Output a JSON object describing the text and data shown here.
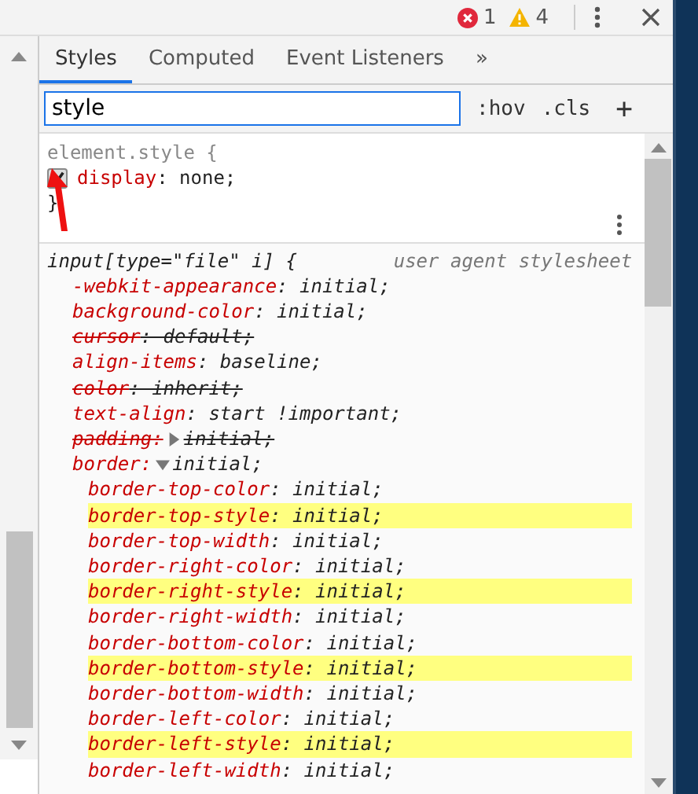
{
  "top_bar": {
    "errors": "1",
    "warnings": "4"
  },
  "tabs": [
    {
      "label": "Styles",
      "selected": true
    },
    {
      "label": "Computed",
      "selected": false
    },
    {
      "label": "Event Listeners",
      "selected": false
    }
  ],
  "tabs_overflow": "»",
  "filter": {
    "value": "style",
    "hov": ":hov",
    "cls": ".cls",
    "add": "+"
  },
  "element_style": {
    "selector": "element.style {",
    "properties": [
      {
        "name": "display",
        "value": ": none;",
        "checked": true
      }
    ],
    "close": "}"
  },
  "rule": {
    "selector": "input[type=\"file\" i] {",
    "source": "user agent stylesheet",
    "properties": [
      {
        "name": "-webkit-appearance",
        "value": ": initial;",
        "overridden": false
      },
      {
        "name": "background-color",
        "value": ": initial;",
        "overridden": false
      },
      {
        "name": "cursor",
        "value": ": default;",
        "overridden": true
      },
      {
        "name": "align-items",
        "value": ": baseline;",
        "overridden": false
      },
      {
        "name": "color",
        "value": ": inherit;",
        "overridden": true
      },
      {
        "name": "text-align",
        "value": ": start !important;",
        "overridden": false
      },
      {
        "name": "padding:",
        "value": "initial;",
        "overridden": true,
        "expanded": false
      },
      {
        "name": "border:",
        "value": "initial;",
        "overridden": false,
        "expanded": true,
        "children": [
          {
            "name": "border-top-color",
            "value": ": initial;",
            "highlighted": false
          },
          {
            "name": "border-top-style",
            "value": ": initial;",
            "highlighted": true
          },
          {
            "name": "border-top-width",
            "value": ": initial;",
            "highlighted": false
          },
          {
            "name": "border-right-color",
            "value": ": initial;",
            "highlighted": false
          },
          {
            "name": "border-right-style",
            "value": ": initial;",
            "highlighted": true
          },
          {
            "name": "border-right-width",
            "value": ": initial;",
            "highlighted": false
          },
          {
            "name": "border-bottom-color",
            "value": ": initial;",
            "highlighted": false
          },
          {
            "name": "border-bottom-style",
            "value": ": initial;",
            "highlighted": true
          },
          {
            "name": "border-bottom-width",
            "value": ": initial;",
            "highlighted": false
          },
          {
            "name": "border-left-color",
            "value": ": initial;",
            "highlighted": false
          },
          {
            "name": "border-left-style",
            "value": ": initial;",
            "highlighted": true
          },
          {
            "name": "border-left-width",
            "value": ": initial;",
            "highlighted": false
          }
        ]
      }
    ]
  }
}
